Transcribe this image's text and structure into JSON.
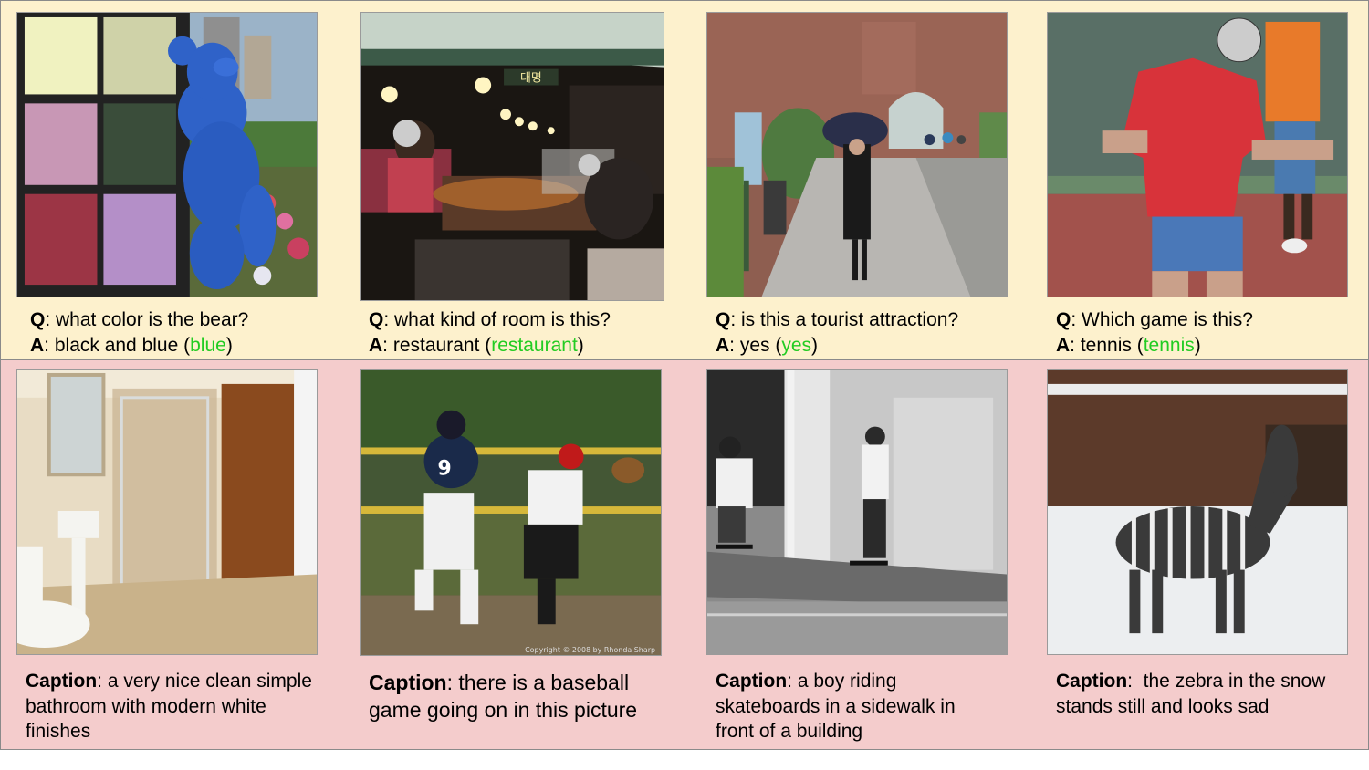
{
  "vqa": [
    {
      "q_label": "Q",
      "question": "what color is the bear?",
      "a_label": "A",
      "answer": "black and blue",
      "gt": "blue"
    },
    {
      "q_label": "Q",
      "question": "what kind of room is this?",
      "a_label": "A",
      "answer": "restaurant",
      "gt": "restaurant"
    },
    {
      "q_label": "Q",
      "question": "is this a tourist attraction?",
      "a_label": "A",
      "answer": "yes",
      "gt": "yes"
    },
    {
      "q_label": "Q",
      "question": "Which game is this?",
      "a_label": "A",
      "answer": "tennis",
      "gt": "tennis"
    }
  ],
  "captions": [
    {
      "label": "Caption",
      "text": "a very nice clean simple bathroom with modern white finishes"
    },
    {
      "label": "Caption",
      "text": "there is a baseball game going on in this picture"
    },
    {
      "label": "Caption",
      "text": "a boy riding skateboards in a sidewalk in front of a building"
    },
    {
      "label": "Caption",
      "text": " the zebra in the snow stands still and looks sad"
    }
  ],
  "photos": {
    "market_sign": "대명",
    "baseball_jersey": "9",
    "watermark": "Copyright © 2008 by Rhonda Sharp"
  },
  "colors": {
    "vqa_band": "#fdf1cd",
    "caption_band": "#f4cccc",
    "ground_truth": "#22cc22"
  }
}
